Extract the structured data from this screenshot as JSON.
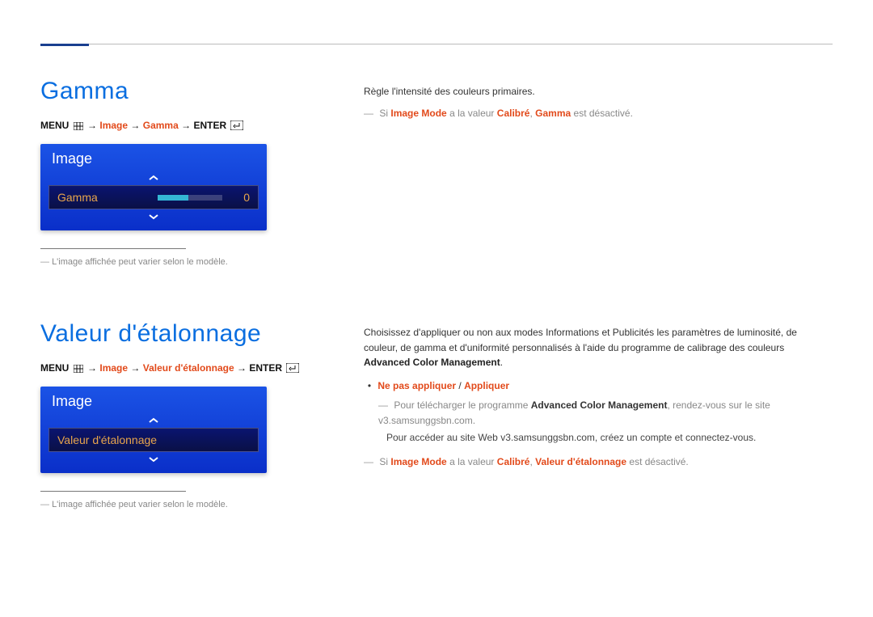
{
  "section1": {
    "heading": "Gamma",
    "nav": {
      "menu": "MENU",
      "p1": "Image",
      "p2": "Gamma",
      "enter": "ENTER"
    },
    "osd": {
      "title": "Image",
      "row_label": "Gamma",
      "row_value": "0"
    },
    "footnote": "L'image affichée peut varier selon le modèle.",
    "right": {
      "desc": "Règle l'intensité des couleurs primaires.",
      "note_pre": "Si",
      "note_imagemode": "Image Mode",
      "note_mid": "a la valeur",
      "note_calibre": "Calibré",
      "note_comma": ",",
      "note_gamma": "Gamma",
      "note_post": "est désactivé."
    }
  },
  "section2": {
    "heading": "Valeur d'étalonnage",
    "nav": {
      "menu": "MENU",
      "p1": "Image",
      "p2": "Valeur d'étalonnage",
      "enter": "ENTER"
    },
    "osd": {
      "title": "Image",
      "row_label": "Valeur d'étalonnage"
    },
    "footnote": "L'image affichée peut varier selon le modèle.",
    "right": {
      "desc": "Choisissez d'appliquer ou non aux modes Informations et Publicités les paramètres de luminosité, de couleur, de gamma et d'uniformité personnalisés à l'aide du programme de calibrage des couleurs",
      "desc_bold": "Advanced Color Management",
      "desc_end": ".",
      "bullet_a": "Ne pas appliquer",
      "bullet_sep": " / ",
      "bullet_b": "Appliquer",
      "dl_pre": "Pour télécharger le programme",
      "dl_bold": "Advanced Color Management",
      "dl_post": ", rendez-vous sur le site v3.samsunggsbn.com.",
      "dl_sub": "Pour accéder au site Web v3.samsunggsbn.com, créez un compte et connectez-vous.",
      "note_pre": "Si",
      "note_imagemode": "Image Mode",
      "note_mid": "a la valeur",
      "note_calibre": "Calibré",
      "note_comma": ",",
      "note_param": "Valeur d'étalonnage",
      "note_post": "est désactivé."
    }
  }
}
